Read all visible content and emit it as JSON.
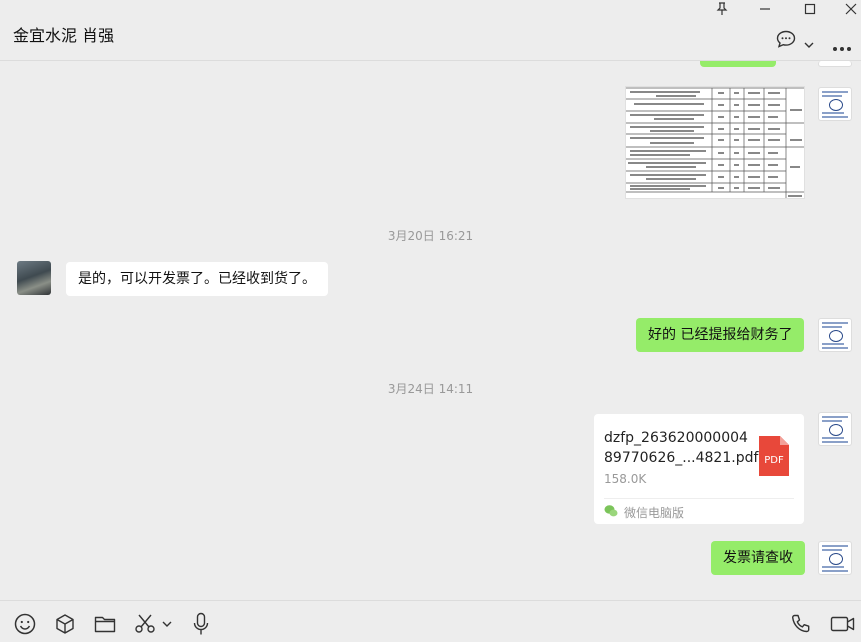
{
  "window": {
    "title": "金宜水泥 肖强"
  },
  "colors": {
    "bubble_mine": "#95ec69",
    "bubble_peer": "#ffffff",
    "background": "#ededed"
  },
  "messages": {
    "ts1": "3月20日 16:21",
    "peer_msg": "是的，可以开发票了。已经收到货了。",
    "my_msg1": "好的 已经提报给财务了",
    "ts2": "3月24日 14:11",
    "file": {
      "name_line1": "dzfp_263620000004",
      "name_line2": "89770626_...4821.pdf",
      "size": "158.0K",
      "source": "微信电脑版",
      "icon_label": "PDF"
    },
    "my_msg2": "发票请查收"
  },
  "icons": {
    "window_controls": [
      "pin-icon",
      "minimize-icon",
      "maximize-icon",
      "close-icon"
    ],
    "header": [
      "chat-bubble-icon",
      "chevron-down-icon",
      "more-icon"
    ],
    "toolbar_left": [
      "emoji-icon",
      "cube-icon",
      "folder-icon",
      "scissors-icon",
      "chevron-down-icon",
      "microphone-icon"
    ],
    "toolbar_right": [
      "phone-icon",
      "video-icon"
    ]
  }
}
